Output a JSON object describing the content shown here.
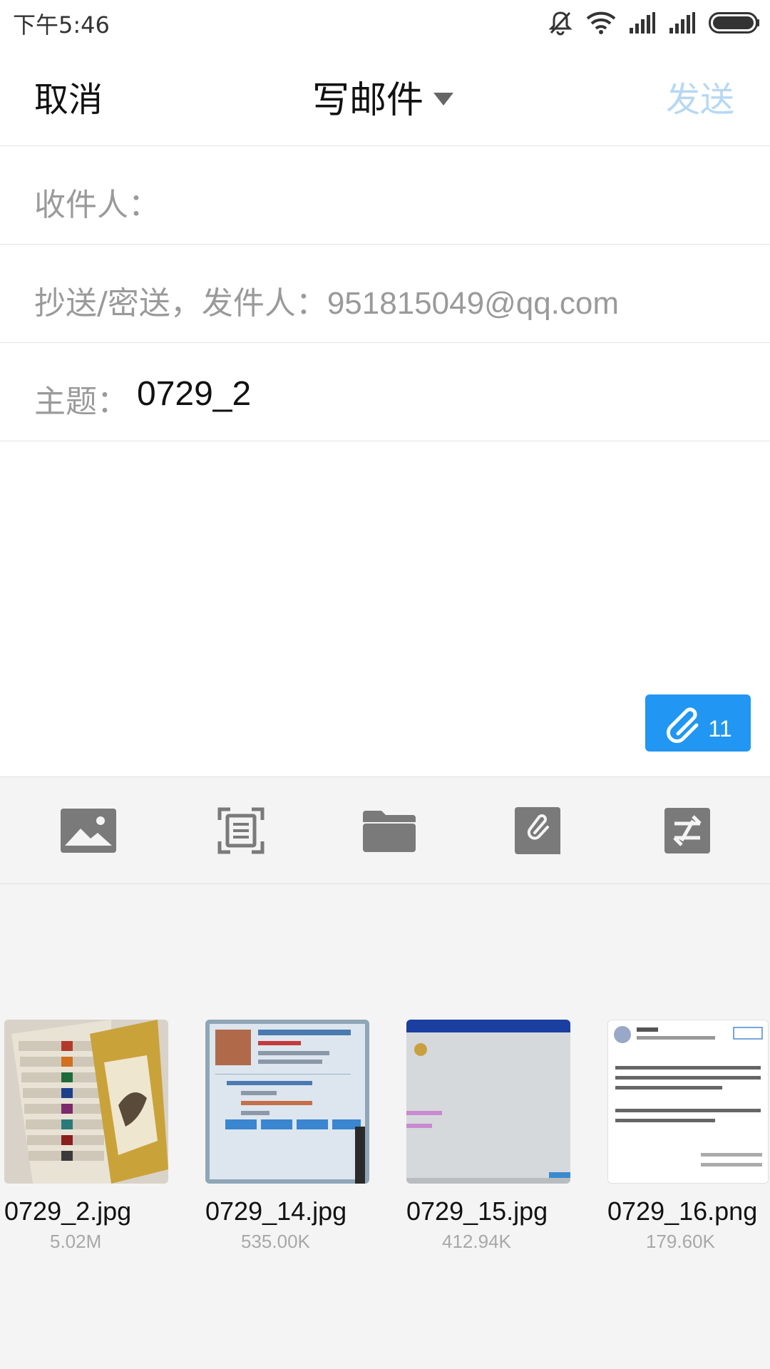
{
  "status": {
    "time": "下午5:46"
  },
  "header": {
    "cancel": "取消",
    "title": "写邮件",
    "send": "发送"
  },
  "fields": {
    "to_label": "收件人：",
    "cc_label": "抄送/密送，发件人：",
    "sender": "951815049@qq.com",
    "subject_label": "主题：",
    "subject_value": "0729_2"
  },
  "attach_button": {
    "count": "11"
  },
  "toolbar": {
    "items": [
      {
        "icon": "image-icon"
      },
      {
        "icon": "scan-document-icon"
      },
      {
        "icon": "folder-icon"
      },
      {
        "icon": "attachment-note-icon"
      },
      {
        "icon": "transfer-icon"
      }
    ]
  },
  "attachments": [
    {
      "name": "0729_2.jpg",
      "size": "5.02M"
    },
    {
      "name": "0729_14.jpg",
      "size": "535.00K"
    },
    {
      "name": "0729_15.jpg",
      "size": "412.94K"
    },
    {
      "name": "0729_16.png",
      "size": "179.60K"
    }
  ],
  "colors": {
    "accent": "#2196f3",
    "send_disabled": "#b7d8f3",
    "label_gray": "#9a9a9a",
    "panel_bg": "#f4f4f4"
  }
}
